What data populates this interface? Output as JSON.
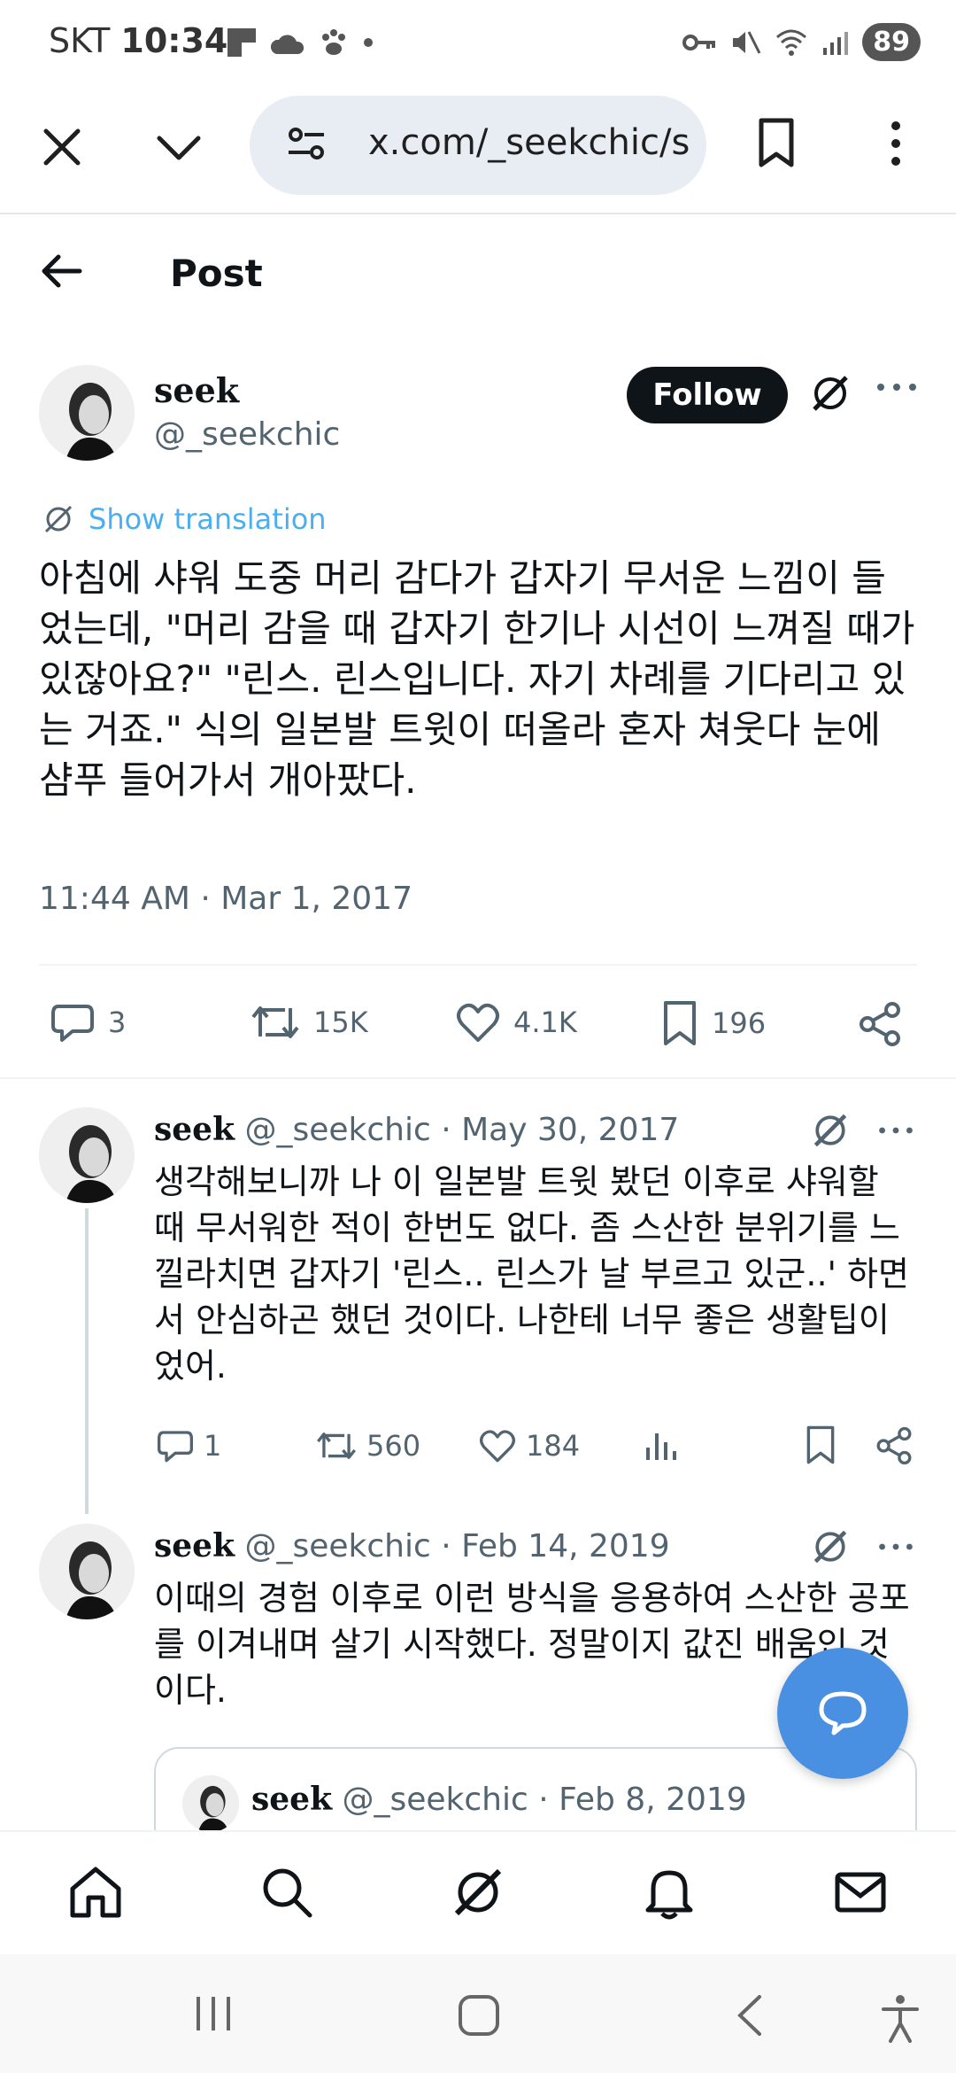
{
  "status_bar": {
    "carrier": "SKT",
    "time": "10:34",
    "battery": "89"
  },
  "browser": {
    "url": "x.com/_seekchic/s"
  },
  "header": {
    "title": "Post"
  },
  "main_post": {
    "name": "seek",
    "handle": "@_seekchic",
    "follow_label": "Follow",
    "translation_label": "Show translation",
    "text": "아침에 샤워 도중 머리 감다가 갑자기 무서운 느낌이 들었는데, \"머리 감을 때 갑자기 한기나 시선이 느껴질 때가 있잖아요?\" \"린스. 린스입니다. 자기 차례를 기다리고 있는 거죠.\" 식의 일본발 트윗이 떠올라 혼자 쳐웃다 눈에 샴푸 들어가서 개아팠다.",
    "timestamp": "11:44 AM · Mar 1, 2017",
    "replies": "3",
    "reposts": "15K",
    "likes": "4.1K",
    "bookmarks": "196"
  },
  "reply1": {
    "name": "seek",
    "meta": "@_seekchic · May 30, 2017",
    "text": "생각해보니까 나 이 일본발 트윗 봤던 이후로 샤워할 때 무서워한 적이 한번도 없다. 좀 스산한 분위기를 느낄라치면 갑자기 '린스.. 린스가 날 부르고 있군..' 하면서 안심하곤 했던 것이다. 나한테 너무 좋은 생활팁이었어.",
    "replies": "1",
    "reposts": "560",
    "likes": "184"
  },
  "reply2": {
    "name": "seek",
    "meta": "@_seekchic · Feb 14, 2019",
    "text": "이때의 경험 이후로 이런 방식을 응용하여 스산한 공포를 이겨내며 살기 시작했다. 정말이지 값진 배움인 것이다."
  },
  "quote": {
    "name": "seek",
    "meta": "@_seekchic · Feb 8, 2019"
  },
  "colors": {
    "accent": "#1d9bf0",
    "fab": "#4a90e2",
    "text_secondary": "#536471"
  }
}
